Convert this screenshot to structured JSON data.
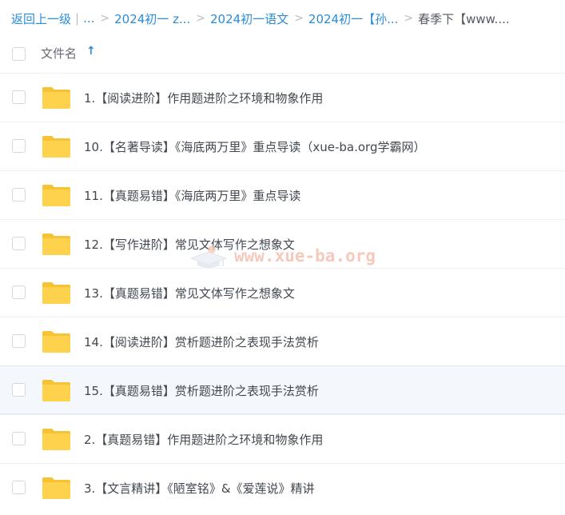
{
  "breadcrumb": {
    "back": "返回上一级",
    "separator": "|",
    "ellipsis": "...",
    "chevron": ">",
    "crumbs": [
      "2024初一 z...",
      "2024初一语文",
      "2024初一【孙..."
    ],
    "current": "春季下【www...."
  },
  "header": {
    "column_label": "文件名",
    "sort_icon": "arrow-up-icon",
    "sort_glyph": "↑"
  },
  "files": [
    {
      "name": "1.【阅读进阶】作用题进阶之环境和物象作用",
      "icon": "folder-icon"
    },
    {
      "name": "10.【名著导读】《海底两万里》重点导读（xue-ba.org学霸网）",
      "icon": "folder-icon"
    },
    {
      "name": "11.【真题易错】《海底两万里》重点导读",
      "icon": "folder-icon"
    },
    {
      "name": "12.【写作进阶】常见文体写作之想象文",
      "icon": "folder-icon"
    },
    {
      "name": "13.【真题易错】常见文体写作之想象文",
      "icon": "folder-icon"
    },
    {
      "name": "14.【阅读进阶】赏析题进阶之表现手法赏析",
      "icon": "folder-icon"
    },
    {
      "name": "15.【真题易错】赏析题进阶之表现手法赏析",
      "icon": "folder-icon"
    },
    {
      "name": "2.【真题易错】作用题进阶之环境和物象作用",
      "icon": "folder-icon"
    },
    {
      "name": "3.【文言精讲】《陋室铭》&《爱莲说》精讲",
      "icon": "folder-icon"
    }
  ],
  "watermark": {
    "text": "www.xue-ba.org"
  },
  "colors": {
    "link": "#2a8cd8",
    "folder": "#ffd24d",
    "folder_back": "#f7c234",
    "hover_row": "#f4f8fd",
    "watermark": "#f3b8a6"
  }
}
